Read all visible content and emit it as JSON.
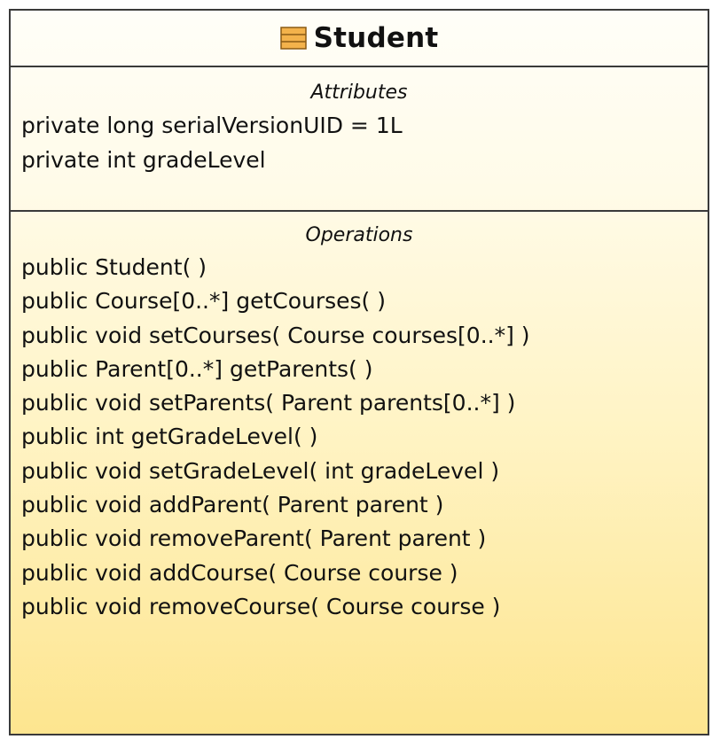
{
  "class": {
    "name": "Student",
    "icon": "class-icon",
    "accent_color": "#f0b14a"
  },
  "attributes": {
    "title": "Attributes",
    "items": [
      "private long serialVersionUID = 1L",
      "private int gradeLevel"
    ]
  },
  "operations": {
    "title": "Operations",
    "items": [
      "public Student( )",
      "public Course[0..*]  getCourses( )",
      "public void  setCourses( Course courses[0..*] )",
      "public Parent[0..*]  getParents( )",
      "public void  setParents( Parent parents[0..*] )",
      "public int  getGradeLevel( )",
      "public void  setGradeLevel( int gradeLevel )",
      "public void  addParent( Parent parent )",
      "public void  removeParent( Parent parent )",
      "public void  addCourse( Course course )",
      "public void  removeCourse( Course course )"
    ]
  }
}
